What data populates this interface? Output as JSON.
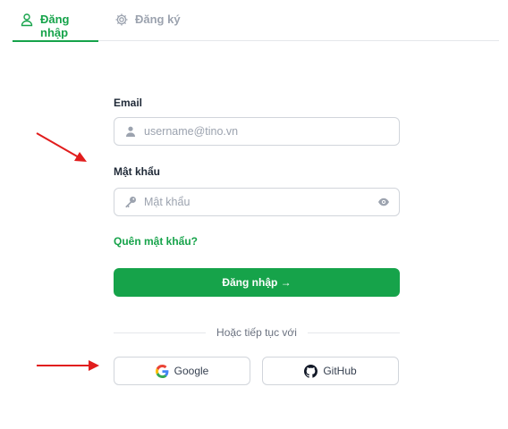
{
  "tabs": {
    "login": {
      "label": "Đăng nhập",
      "icon": "user-icon",
      "active": true
    },
    "register": {
      "label": "Đăng ký",
      "icon": "gear-icon",
      "active": false
    }
  },
  "form": {
    "email": {
      "label": "Email",
      "placeholder": "username@tino.vn",
      "value": "",
      "icon": "user-icon"
    },
    "password": {
      "label": "Mật khẩu",
      "placeholder": "Mật khẩu",
      "value": "",
      "icon": "key-icon",
      "toggle_icon": "eye-icon"
    },
    "forgot_label": "Quên mật khẩu?",
    "submit_label": "Đăng nhập →"
  },
  "social": {
    "divider_text": "Hoặc tiếp tục với",
    "google_label": "Google",
    "github_label": "GitHub"
  },
  "colors": {
    "accent": "#16a34a",
    "annotation_arrow": "#e11d1d"
  }
}
